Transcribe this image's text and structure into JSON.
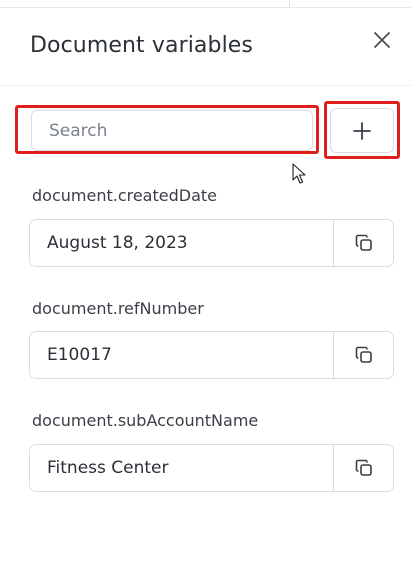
{
  "panel": {
    "title": "Document variables",
    "close_icon": "close-icon"
  },
  "search": {
    "placeholder": "Search",
    "value": ""
  },
  "toolbar": {
    "add_icon": "plus-icon"
  },
  "variables": [
    {
      "name": "document.createdDate",
      "value": "August 18, 2023",
      "action_icon": "copy-icon"
    },
    {
      "name": "document.refNumber",
      "value": "E10017",
      "action_icon": "copy-icon"
    },
    {
      "name": "document.subAccountName",
      "value": "Fitness Center",
      "action_icon": "copy-icon"
    }
  ],
  "colors": {
    "highlight": "#e01e1e",
    "border": "#d9dce1",
    "text": "#2b3036",
    "placeholder": "#7b828c"
  }
}
